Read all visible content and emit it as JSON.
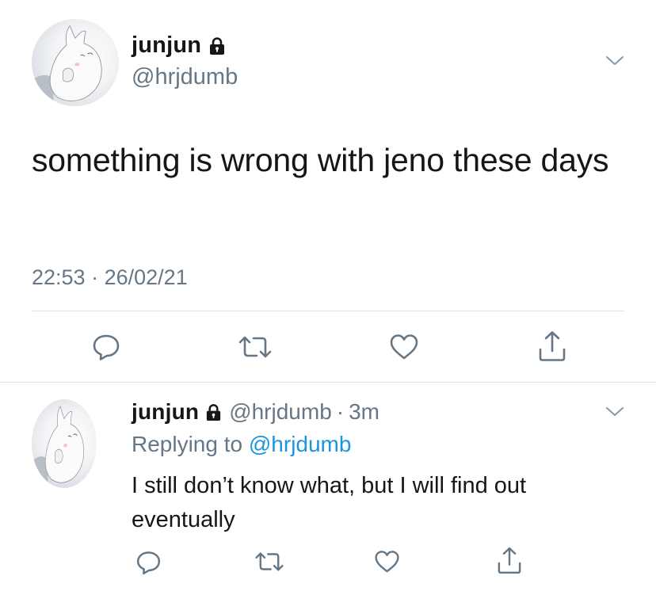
{
  "main_tweet": {
    "author": {
      "display_name": "junjun",
      "handle": "@hrjdumb",
      "avatar_icon": "moomin-avatar-icon",
      "lock_icon": "lock-icon"
    },
    "text": "something is wrong with jeno these days",
    "time": "22:53",
    "separator": "·",
    "date": "26/02/21",
    "menu_icon": "chevron-down-icon",
    "actions": [
      {
        "name": "reply",
        "icon": "reply-icon"
      },
      {
        "name": "retweet",
        "icon": "retweet-icon"
      },
      {
        "name": "like",
        "icon": "heart-icon"
      },
      {
        "name": "share",
        "icon": "share-icon"
      }
    ]
  },
  "reply_tweet": {
    "author": {
      "display_name": "junjun",
      "handle": "@hrjdumb",
      "avatar_icon": "moomin-avatar-icon",
      "lock_icon": "lock-icon"
    },
    "separator": "·",
    "relative_time": "3m",
    "replying_prefix": "Replying to",
    "replying_to": "@hrjdumb",
    "text": "I still don’t know what, but I will find out eventually",
    "menu_icon": "chevron-down-icon",
    "actions": [
      {
        "name": "reply",
        "icon": "reply-icon"
      },
      {
        "name": "retweet",
        "icon": "retweet-icon"
      },
      {
        "name": "like",
        "icon": "heart-icon"
      },
      {
        "name": "share",
        "icon": "share-icon"
      }
    ]
  },
  "colors": {
    "primary_text": "#14171a",
    "secondary_text": "#657786",
    "link": "#1b95e0",
    "divider": "#dfe3e7"
  }
}
